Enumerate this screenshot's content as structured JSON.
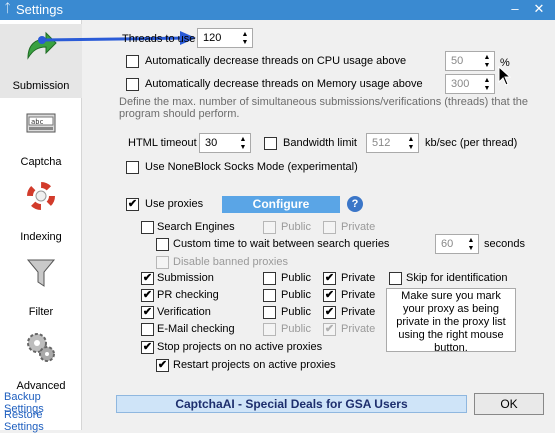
{
  "window": {
    "title": "Settings",
    "minimize": "–",
    "close": "✕"
  },
  "sidebar": {
    "items": [
      {
        "label": "Submission",
        "icon": "arrow-icon",
        "active": true
      },
      {
        "label": "Captcha",
        "icon": "captcha-icon"
      },
      {
        "label": "Indexing",
        "icon": "lifebuoy-icon"
      },
      {
        "label": "Filter",
        "icon": "funnel-icon"
      },
      {
        "label": "Advanced",
        "icon": "gears-icon"
      }
    ],
    "backup": "Backup Settings",
    "restore": "Restore Settings"
  },
  "threads": {
    "label": "Threads to use",
    "value": "120",
    "cpu_label": "Automatically decrease threads on CPU usage above",
    "cpu_value": "50",
    "cpu_unit": "%",
    "mem_label": "Automatically decrease threads on Memory usage above",
    "mem_value": "300",
    "description": "Define the max. number of simultaneous submissions/verifications (threads) that the program should perform."
  },
  "html": {
    "timeout_label": "HTML timeout",
    "timeout_value": "30",
    "bandwidth_label": "Bandwidth limit",
    "bandwidth_value": "512",
    "bandwidth_unit": "kb/sec (per thread)"
  },
  "socks": {
    "label": "Use NoneBlock Socks Mode (experimental)"
  },
  "proxies": {
    "use_label": "Use proxies",
    "configure": "Configure",
    "help": "?",
    "search_engines": "Search Engines",
    "public": "Public",
    "private": "Private",
    "custom_time": "Custom time to wait between search queries",
    "custom_time_value": "60",
    "seconds": "seconds",
    "disable_banned": "Disable banned proxies",
    "submission": "Submission",
    "pr_checking": "PR checking",
    "verification": "Verification",
    "email_checking": "E-Mail checking",
    "skip_identification": "Skip for identification",
    "note": "Make sure you mark your proxy as being private in the proxy list using the right mouse button.",
    "stop_projects": "Stop projects on no active proxies",
    "restart_projects": "Restart projects on active proxies"
  },
  "footer": {
    "banner": "CaptchaAI - Special Deals for GSA Users",
    "ok": "OK"
  },
  "colors": {
    "titlebar": "#3a8ad1",
    "configure": "#5aa5e6",
    "banner_bg": "#cfe4f8",
    "arrow": "#2a5bd7"
  }
}
